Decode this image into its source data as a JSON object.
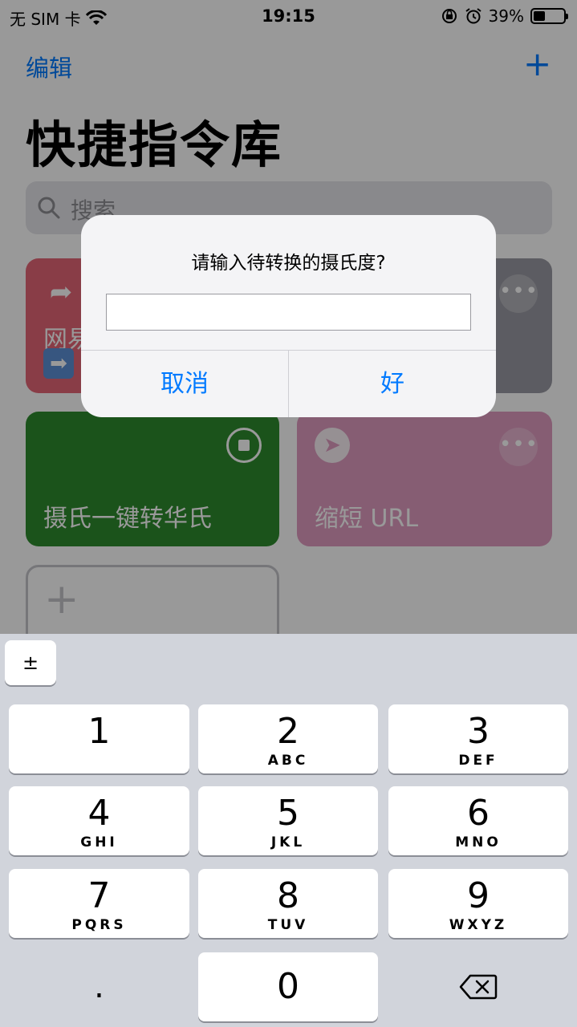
{
  "status_bar": {
    "carrier": "无 SIM 卡",
    "time": "19:15",
    "battery_percent": "39%",
    "battery_level": 0.39
  },
  "nav": {
    "edit_label": "编辑",
    "add_label": "+"
  },
  "page": {
    "title": "快捷指令库",
    "search_placeholder": "搜索"
  },
  "cards": [
    {
      "title": "网易",
      "color": "#e56677"
    },
    {
      "title": "",
      "color": "#9a9aa3"
    },
    {
      "title": "摄氏一键转华氏",
      "color": "#2e8b2e"
    },
    {
      "title": "缩短 URL",
      "color": "#e09bc0"
    }
  ],
  "create_card": {
    "icon": "plus-icon"
  },
  "alert": {
    "title": "请输入待转换的摄氏度?",
    "input_value": "",
    "cancel_label": "取消",
    "ok_label": "好"
  },
  "keyboard": {
    "plus_minus": "±",
    "keys": [
      {
        "num": "1",
        "letters": ""
      },
      {
        "num": "2",
        "letters": "ABC"
      },
      {
        "num": "3",
        "letters": "DEF"
      },
      {
        "num": "4",
        "letters": "GHI"
      },
      {
        "num": "5",
        "letters": "JKL"
      },
      {
        "num": "6",
        "letters": "MNO"
      },
      {
        "num": "7",
        "letters": "PQRS"
      },
      {
        "num": "8",
        "letters": "TUV"
      },
      {
        "num": "9",
        "letters": "WXYZ"
      },
      {
        "num": "0",
        "letters": ""
      }
    ],
    "dot": "."
  }
}
